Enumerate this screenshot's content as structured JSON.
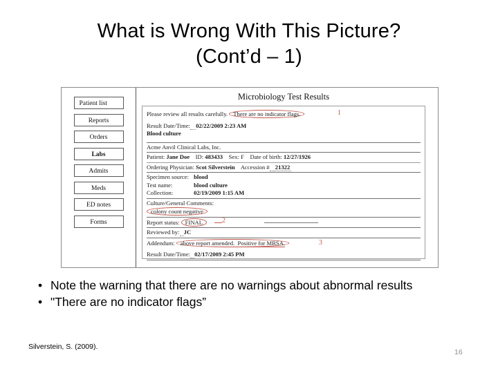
{
  "slide": {
    "title_line1": "What is Wrong With This Picture?",
    "title_line2": "(Cont’d – 1)",
    "citation": "Silverstein, S. (2009).",
    "slide_number": "16",
    "accent_red": "#c0564a"
  },
  "ehr": {
    "sidebar": {
      "items": [
        {
          "label": "Patient list",
          "active": false
        },
        {
          "label": "Reports",
          "active": false
        },
        {
          "label": "Orders",
          "active": false
        },
        {
          "label": "Labs",
          "active": true
        },
        {
          "label": "Admits",
          "active": false
        },
        {
          "label": "Meds",
          "active": false
        },
        {
          "label": "ED notes",
          "active": false
        },
        {
          "label": "Forms",
          "active": false
        }
      ]
    },
    "report": {
      "heading": "Microbiology Test Results",
      "review_notice": "Please review all results carefully.",
      "no_flags_text": "There are no indicator flags.",
      "annotation_1": "1",
      "result_datetime_label": "Result Date/Time:",
      "result_datetime_value": "02/22/2009   2:23 AM",
      "test_title": "Blood culture",
      "lab_name": "Acme Anvil Clinical Labs, Inc.",
      "patient_label": "Patient:",
      "patient_value": "Jane Doe",
      "id_label": "ID:",
      "id_value": "483433",
      "sex_label": "Sex:",
      "sex_value": "F",
      "dob_label": "Date of birth:",
      "dob_value": "12/27/1926",
      "physician_label": "Ordering Physician:",
      "physician_value": "Scot Silverstein",
      "accession_label": "Accession #",
      "accession_value": "21322",
      "specimen_label": "Specimen source:",
      "specimen_value": "blood",
      "testname_label": "Test name:",
      "testname_value": "blood culture",
      "collection_label": "Collection:",
      "collection_value": "02/19/2009   1:15 AM",
      "comments_label": "Culture/General Comments:",
      "comments_value": "colony count  negative",
      "status_label": "Report status:",
      "status_value": "FINAL",
      "annotation_2": "2",
      "reviewed_label": "Reviewed by:",
      "reviewed_value": "JC",
      "addendum_label": "Addendum:",
      "addendum_text_1": "above report amended.",
      "addendum_text_2": "Positive for MRSA.",
      "annotation_3": "3",
      "result_datetime_label_2": "Result Date/Time:",
      "result_datetime_value_2": "02/17/2009   2:45 PM"
    }
  },
  "bullets": [
    {
      "marker": "•",
      "text": "Note the warning that there are no warnings about abnormal results"
    },
    {
      "marker": "•",
      "text": "\"There are no indicator flags”"
    }
  ]
}
